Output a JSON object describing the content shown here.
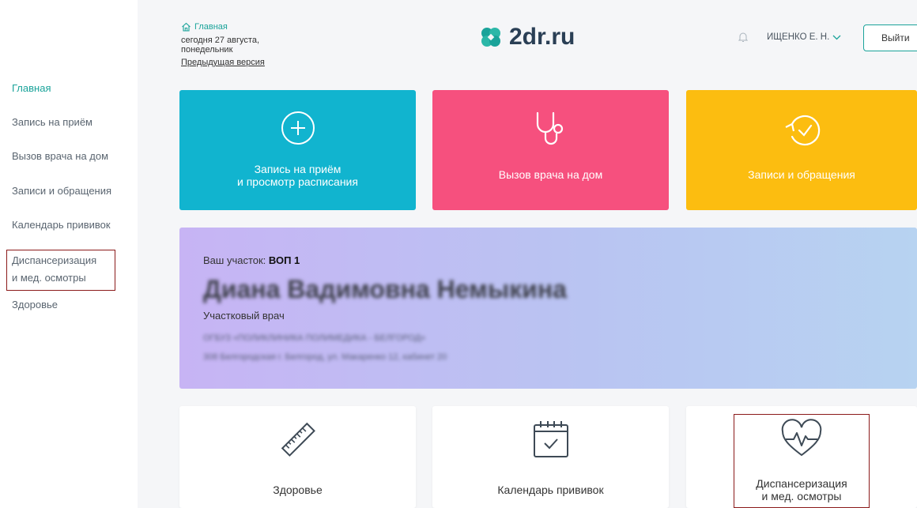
{
  "sidebar": {
    "items": [
      {
        "label": "Главная"
      },
      {
        "label": "Запись на приём"
      },
      {
        "label": "Вызов врача на дом"
      },
      {
        "label": "Записи и обращения"
      },
      {
        "label": "Календарь прививок"
      },
      {
        "label_line1": "Диспансеризация",
        "label_line2": "и мед. осмотры"
      },
      {
        "label": "Здоровье"
      }
    ]
  },
  "header": {
    "home_link": "Главная",
    "date_line1": "сегодня 27 августа,",
    "date_line2": "понедельник",
    "prev_version": "Предыдущая версия",
    "logo_text": "2dr.ru",
    "user_name": "ИЩЕНКО Е. Н.",
    "logout_label": "Выйти"
  },
  "tiles": [
    {
      "line1": "Запись на приём",
      "line2": "и просмотр расписания",
      "color": "#11b4cf",
      "icon": "plus-circle-icon"
    },
    {
      "line1": "Вызов врача на дом",
      "color": "#f6507e",
      "icon": "stethoscope-icon"
    },
    {
      "line1": "Записи и обращения",
      "color": "#fcbd10",
      "icon": "history-check-icon"
    }
  ],
  "district": {
    "label": "Ваш участок:",
    "value": "ВОП 1",
    "doctor_name": "Диана Вадимовна Немыкина",
    "role": "Участковый врач",
    "address_line1": "ОГБУЗ «ПОЛИКЛИНИКА ПОЛИМЕДИКА - БЕЛГОРОД»",
    "address_line2": "308 Белгородская г. Белгород, ул. Макаренко 12, кабинет 20"
  },
  "cards": [
    {
      "label": "Здоровье",
      "icon": "ruler-icon"
    },
    {
      "label": "Календарь прививок",
      "icon": "calendar-check-icon"
    },
    {
      "line1": "Диспансеризация",
      "line2": "и мед. осмотры",
      "icon": "heart-pulse-icon"
    }
  ]
}
